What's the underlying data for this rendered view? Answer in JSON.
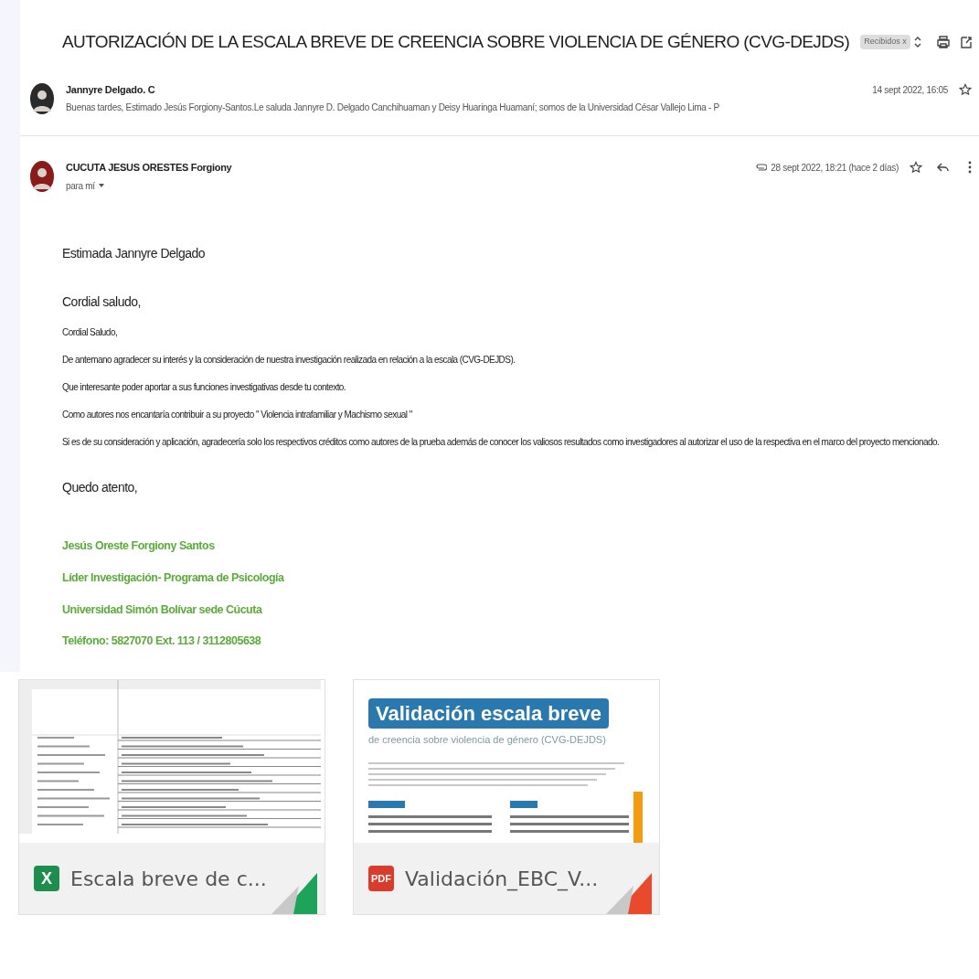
{
  "thread": {
    "subject": "AUTORIZACIÓN DE LA ESCALA BREVE DE CREENCIA SOBRE VIOLENCIA DE GÉNERO (CVG-DEJDS)",
    "label": "Recibidos x"
  },
  "messages": [
    {
      "kind": "collapsed",
      "sender": "Jannyre Delgado. C",
      "snippet": "Buenas tardes, Estimado Jesús Forgiony-Santos.Le saluda Jannyre D. Delgado Canchihuaman y Deisy Huaringa Huamaní; somos de la Universidad César Vallejo Lima - P",
      "date": "14 sept 2022, 16:05",
      "starred": false
    },
    {
      "kind": "expanded",
      "sender": "CUCUTA JESUS ORESTES Forgiony",
      "recipient": "para mí",
      "date": "28 sept 2022, 18:21 (hace 2 días)",
      "starred": false,
      "body": [
        {
          "kind": "large",
          "text": "Estimada Jannyre Delgado"
        },
        {
          "kind": "large",
          "text": "Cordial saludo,"
        },
        {
          "kind": "small",
          "text": "Cordial Saludo,"
        },
        {
          "kind": "small",
          "text": "De antemano agradecer su interés y la consideración de nuestra investigación realizada en relación a la escala (CVG-DEJDS)."
        },
        {
          "kind": "small",
          "text": "Que interesante poder aportar a sus funciones investigativas desde tu contexto."
        },
        {
          "kind": "small",
          "text": "Como autores nos encantaría contribuir a su  proyecto \" Violencia intrafamiliar y Machismo sexual  \""
        },
        {
          "kind": "small",
          "text": "Si es de su consideración y aplicación, agradecería solo los respectivos créditos como autores de la prueba además de conocer los valiosos resultados  como investigadores al autorizar el uso de la respectiva en el marco del proyecto mencionado."
        },
        {
          "kind": "large",
          "text": "Quedo atento,"
        }
      ],
      "signature": [
        "Jesús Oreste Forgiony Santos",
        "Líder  Investigación- Programa de Psicología",
        "Universidad Simón Bolívar sede Cúcuta",
        "Teléfono: 5827070 Ext. 113 / 3112805638"
      ]
    }
  ],
  "attachments": [
    {
      "kind": "spreadsheet",
      "badge": "X",
      "name": "Escala breve de c..."
    },
    {
      "kind": "pdf",
      "badge": "PDF",
      "name": "Validación_EBC_V...",
      "preview_title": "Validación escala breve",
      "preview_subtitle": "de creencia sobre violencia de género (CVG-DEJDS)"
    }
  ]
}
